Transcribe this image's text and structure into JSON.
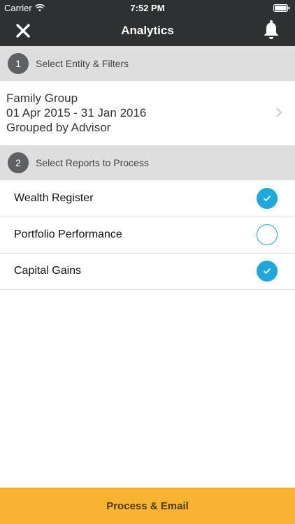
{
  "status_bar": {
    "carrier": "Carrier",
    "time": "7:52 PM"
  },
  "nav": {
    "title": "Analytics",
    "left_icon": "close-icon",
    "right_icon": "bell-icon"
  },
  "sections": [
    {
      "number": "1",
      "title": "Select Entity & Filters"
    },
    {
      "number": "2",
      "title": "Select Reports to Process"
    }
  ],
  "entity": {
    "name": "Family Group",
    "date_range": "01 Apr 2015 - 31 Jan 2016",
    "grouping": "Grouped by Advisor"
  },
  "reports": [
    {
      "label": "Wealth Register",
      "selected": true
    },
    {
      "label": "Portfolio Performance",
      "selected": false
    },
    {
      "label": "Capital Gains",
      "selected": true
    }
  ],
  "action": {
    "label": "Process & Email"
  },
  "colors": {
    "header": "#2f3032",
    "section": "#dedede",
    "accent": "#1fa8dc",
    "button": "#f8b431"
  }
}
